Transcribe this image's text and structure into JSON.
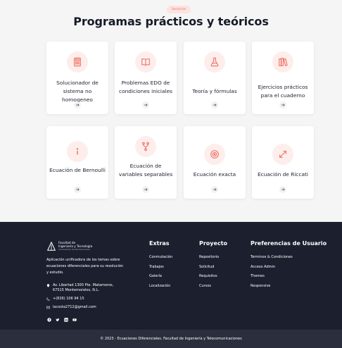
{
  "section": {
    "badge": "Servicios",
    "title": "Programas prácticos y teóricos"
  },
  "cards": [
    {
      "label": "Solucionador de sistema no homogeneo",
      "icon": "calculator-icon"
    },
    {
      "label": "Problemas EDO de condiciones iniciales",
      "icon": "book-open-icon"
    },
    {
      "label": "Teoría y fórmulas",
      "icon": "flask-icon"
    },
    {
      "label": "Ejercicios prácticos para el cuaderno",
      "icon": "books-icon"
    },
    {
      "label": "Ecuación de Bernoulli",
      "icon": "info-icon"
    },
    {
      "label": "Ecuación de variables separables",
      "icon": "fork-icon"
    },
    {
      "label": "Ecuación exacta",
      "icon": "target-icon"
    },
    {
      "label": "Ecuación de Riccati",
      "icon": "expand-arrows-icon"
    }
  ],
  "footer": {
    "logo_line1": "Facultad de",
    "logo_line2": "Ingeniería y Tecnología",
    "logo_line3": "Universidad de Montemorelos",
    "description": "Aplicación unificadora de los temas sobre ecuaciones diferenciales para su resolución y estudio.",
    "address": "Av. Libertad 1300 Pte. Matamoros, 67515 Montemorelos, N.L.",
    "phone": "+(826) 106 94 15",
    "email": "lacosta2712@gmail.com",
    "columns": [
      {
        "title": "Extras",
        "links": [
          "Conmutación",
          "Trabajos",
          "Galería",
          "Localización"
        ]
      },
      {
        "title": "Proyecto",
        "links": [
          "Repositorio",
          "Solicitud",
          "Requisitos",
          "Cursos"
        ]
      },
      {
        "title": "Preferencias de Usuario",
        "links": [
          "Terminos & Condiciones",
          "Acceso Admin",
          "Themes",
          "Responsive"
        ]
      }
    ],
    "social": [
      "facebook-icon",
      "twitter-icon",
      "linkedin-icon",
      "youtube-icon"
    ],
    "copyright": "© 2023 - Ecuaciones Diferenciales. Facultad de Ingeniería y Telecomunicaciones"
  },
  "colors": {
    "accent": "#ef6b5e",
    "accent_light": "#fdeeec",
    "footer_bg": "#1b1f2e",
    "bottom_bar_bg": "#2a2e3d"
  }
}
